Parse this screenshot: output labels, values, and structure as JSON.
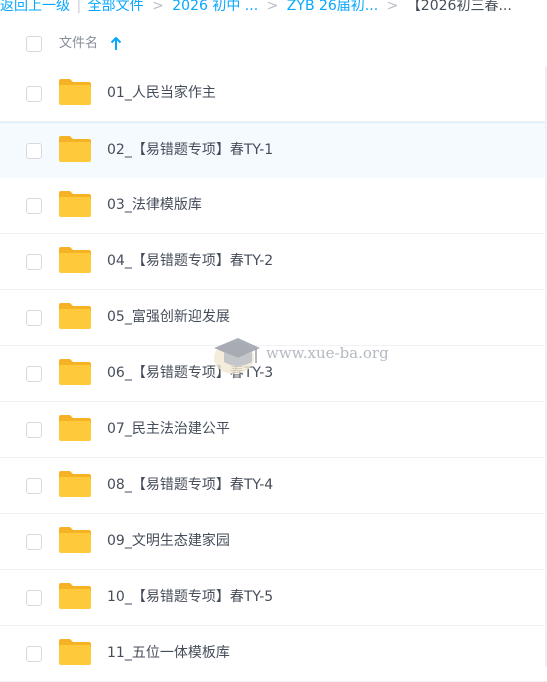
{
  "breadcrumb": {
    "back": "返回上一级",
    "separator": "|",
    "items": [
      "全部文件",
      "2026 初中 ...",
      "ZYB 26届初...",
      "【2026初三春..."
    ],
    "arrow": ">"
  },
  "header": {
    "column_name": "文件名",
    "sort_icon": "arrow-up-icon"
  },
  "files": [
    {
      "name": "01_人民当家作主"
    },
    {
      "name": "02_【易错题专项】春TY-1"
    },
    {
      "name": "03_法律模版库"
    },
    {
      "name": "04_【易错题专项】春TY-2"
    },
    {
      "name": "05_富强创新迎发展"
    },
    {
      "name": "06_【易错题专项】春TY-3"
    },
    {
      "name": "07_民主法治建公平"
    },
    {
      "name": "08_【易错题专项】春TY-4"
    },
    {
      "name": "09_文明生态建家园"
    },
    {
      "name": "10_【易错题专项】春TY-5"
    },
    {
      "name": "11_五位一体模板库"
    }
  ],
  "watermark": {
    "text": "www.xue-ba.org",
    "icon": "graduation-cap-icon"
  },
  "colors": {
    "accent": "#06a7ff",
    "folder": "#ffc93c",
    "folder_back": "#f5b224",
    "highlight_row": "#f5faff",
    "text": "#454d5a"
  }
}
